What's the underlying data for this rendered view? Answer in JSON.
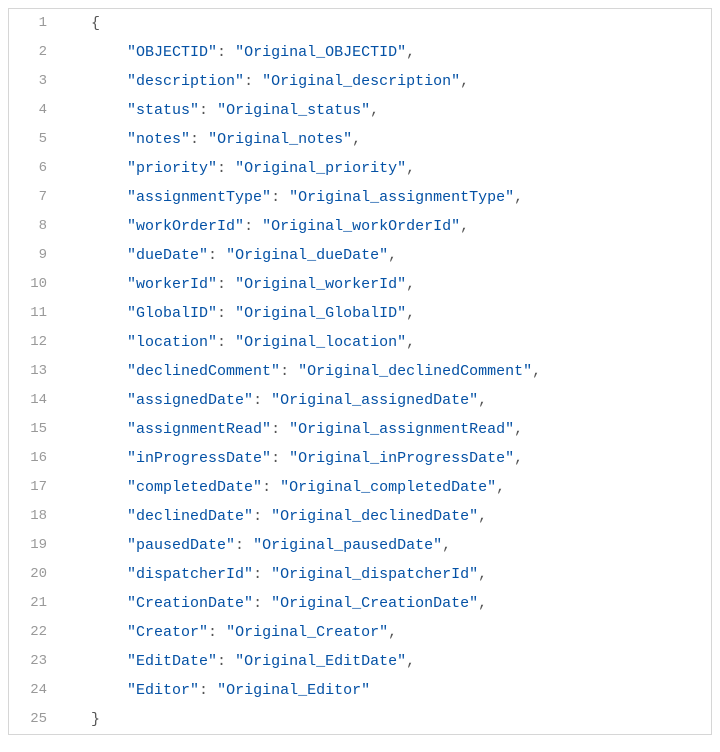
{
  "lines": [
    {
      "num": "1",
      "type": "brace",
      "indent": "indent1",
      "text": "{"
    },
    {
      "num": "2",
      "type": "kv",
      "key": "OBJECTID",
      "value": "Original_OBJECTID",
      "comma": true
    },
    {
      "num": "3",
      "type": "kv",
      "key": "description",
      "value": "Original_description",
      "comma": true
    },
    {
      "num": "4",
      "type": "kv",
      "key": "status",
      "value": "Original_status",
      "comma": true
    },
    {
      "num": "5",
      "type": "kv",
      "key": "notes",
      "value": "Original_notes",
      "comma": true
    },
    {
      "num": "6",
      "type": "kv",
      "key": "priority",
      "value": "Original_priority",
      "comma": true
    },
    {
      "num": "7",
      "type": "kv",
      "key": "assignmentType",
      "value": "Original_assignmentType",
      "comma": true
    },
    {
      "num": "8",
      "type": "kv",
      "key": "workOrderId",
      "value": "Original_workOrderId",
      "comma": true
    },
    {
      "num": "9",
      "type": "kv",
      "key": "dueDate",
      "value": "Original_dueDate",
      "comma": true
    },
    {
      "num": "10",
      "type": "kv",
      "key": "workerId",
      "value": "Original_workerId",
      "comma": true
    },
    {
      "num": "11",
      "type": "kv",
      "key": "GlobalID",
      "value": "Original_GlobalID",
      "comma": true
    },
    {
      "num": "12",
      "type": "kv",
      "key": "location",
      "value": "Original_location",
      "comma": true
    },
    {
      "num": "13",
      "type": "kv",
      "key": "declinedComment",
      "value": "Original_declinedComment",
      "comma": true
    },
    {
      "num": "14",
      "type": "kv",
      "key": "assignedDate",
      "value": "Original_assignedDate",
      "comma": true
    },
    {
      "num": "15",
      "type": "kv",
      "key": "assignmentRead",
      "value": "Original_assignmentRead",
      "comma": true
    },
    {
      "num": "16",
      "type": "kv",
      "key": "inProgressDate",
      "value": "Original_inProgressDate",
      "comma": true
    },
    {
      "num": "17",
      "type": "kv",
      "key": "completedDate",
      "value": "Original_completedDate",
      "comma": true
    },
    {
      "num": "18",
      "type": "kv",
      "key": "declinedDate",
      "value": "Original_declinedDate",
      "comma": true
    },
    {
      "num": "19",
      "type": "kv",
      "key": "pausedDate",
      "value": "Original_pausedDate",
      "comma": true
    },
    {
      "num": "20",
      "type": "kv",
      "key": "dispatcherId",
      "value": "Original_dispatcherId",
      "comma": true
    },
    {
      "num": "21",
      "type": "kv",
      "key": "CreationDate",
      "value": "Original_CreationDate",
      "comma": true
    },
    {
      "num": "22",
      "type": "kv",
      "key": "Creator",
      "value": "Original_Creator",
      "comma": true
    },
    {
      "num": "23",
      "type": "kv",
      "key": "EditDate",
      "value": "Original_EditDate",
      "comma": true
    },
    {
      "num": "24",
      "type": "kv",
      "key": "Editor",
      "value": "Original_Editor",
      "comma": false
    },
    {
      "num": "25",
      "type": "brace",
      "indent": "indent1",
      "text": "}"
    }
  ]
}
